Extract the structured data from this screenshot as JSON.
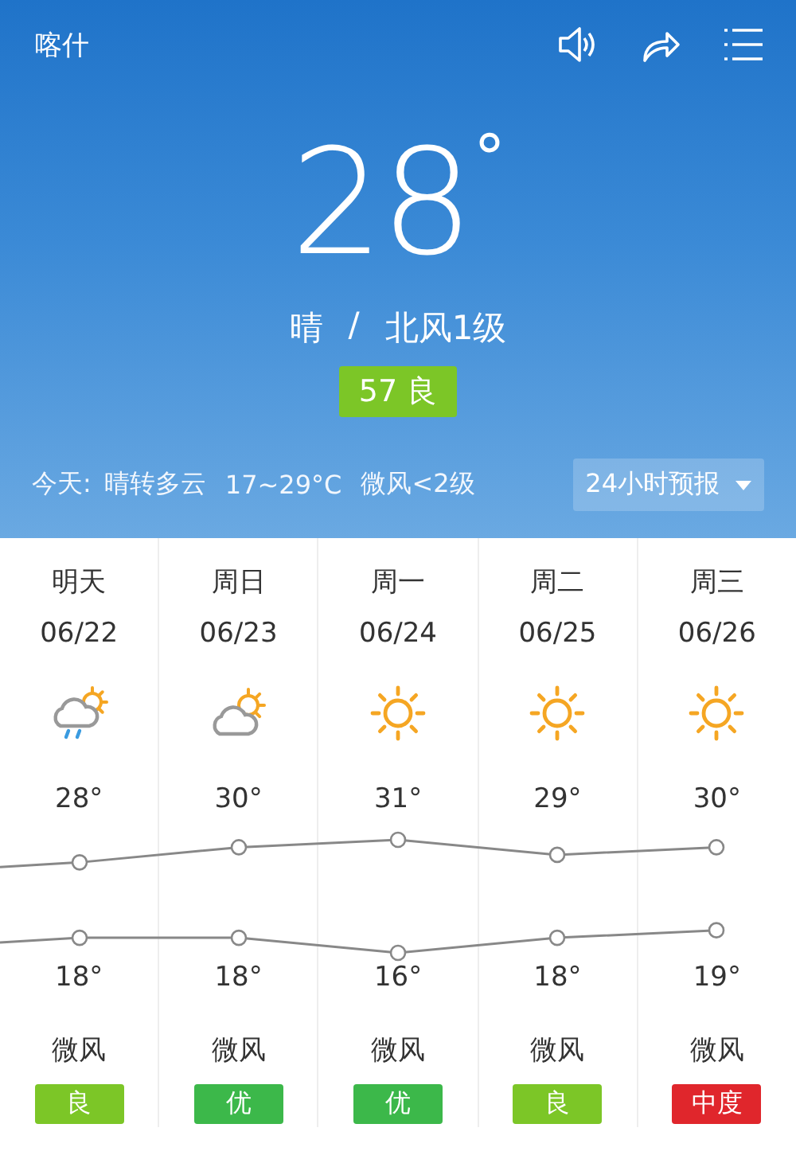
{
  "header": {
    "city": "喀什"
  },
  "current": {
    "temperature": "28",
    "degree": "°",
    "condition": "晴",
    "separator": "/",
    "wind": "北风1级",
    "aqi": "57 良"
  },
  "today": {
    "label": "今天:",
    "condition": "晴转多云",
    "range": "17~29°C",
    "wind": "微风<2级",
    "forecast_button": "24小时预报"
  },
  "days": [
    {
      "name": "明天",
      "date": "06/22",
      "kind": "rain",
      "high": "28°",
      "low": "18°",
      "wind": "微风",
      "aqi": "良",
      "color": "#7cc627"
    },
    {
      "name": "周日",
      "date": "06/23",
      "kind": "cloudy",
      "high": "30°",
      "low": "18°",
      "wind": "微风",
      "aqi": "优",
      "color": "#3cb84a"
    },
    {
      "name": "周一",
      "date": "06/24",
      "kind": "sunny",
      "high": "31°",
      "low": "16°",
      "wind": "微风",
      "aqi": "优",
      "color": "#3cb84a"
    },
    {
      "name": "周二",
      "date": "06/25",
      "kind": "sunny",
      "high": "29°",
      "low": "18°",
      "wind": "微风",
      "aqi": "良",
      "color": "#7cc627"
    },
    {
      "name": "周三",
      "date": "06/26",
      "kind": "sunny",
      "high": "30°",
      "low": "19°",
      "wind": "微风",
      "aqi": "中度",
      "color": "#e0262c"
    }
  ]
}
